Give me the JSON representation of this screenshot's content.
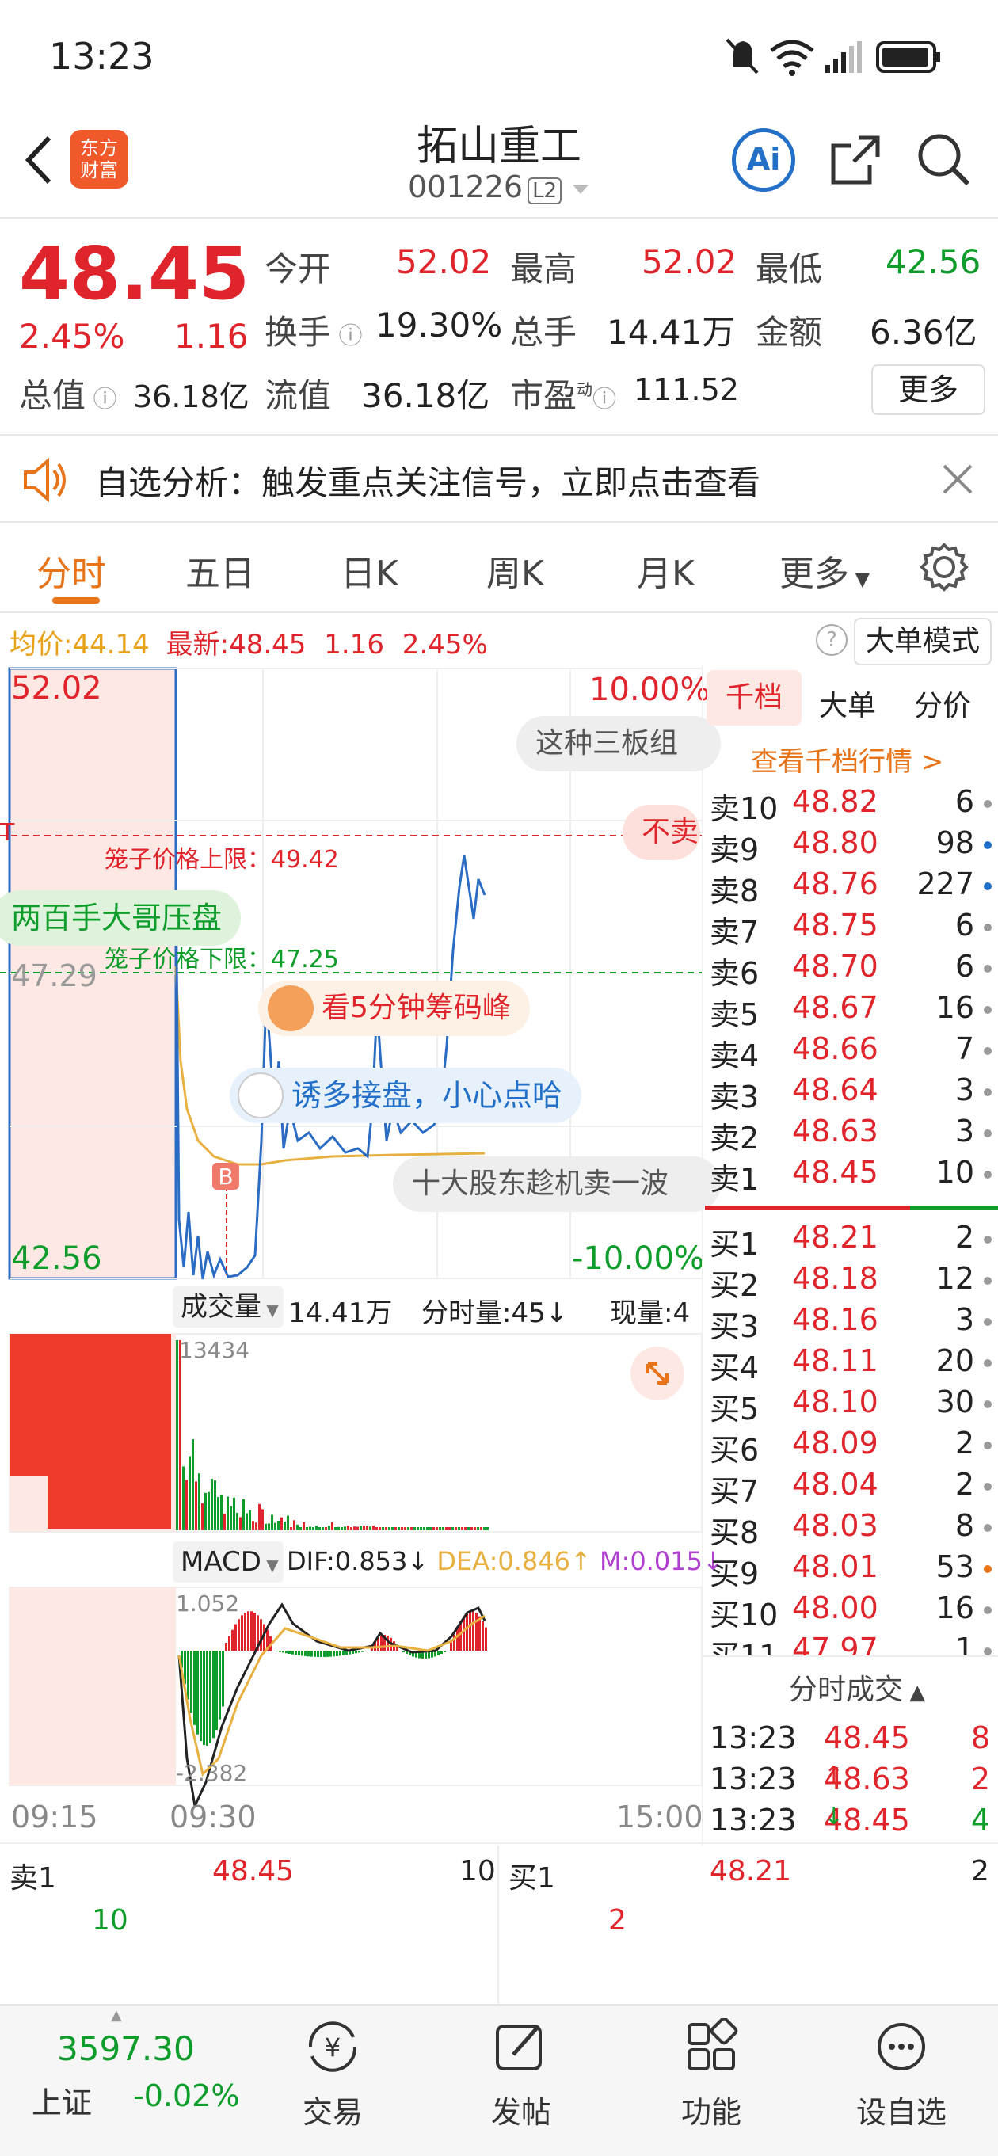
{
  "status_bar": {
    "time": "13:23"
  },
  "header": {
    "back_label": "<",
    "logo_text": "东方财富",
    "title": "拓山重工",
    "code": "001226",
    "level": "L2",
    "ai_label": "Ai"
  },
  "quote": {
    "price": "48.45",
    "change_pct": "2.45%",
    "change": "1.16",
    "open_label": "今开",
    "open": "52.02",
    "high_label": "最高",
    "high": "52.02",
    "low_label": "最低",
    "low": "42.56",
    "turnover_label": "换手",
    "turnover": "19.30%",
    "volume_label": "总手",
    "volume": "14.41万",
    "amount_label": "金额",
    "amount": "6.36亿",
    "mktcap_label": "总值",
    "mktcap": "36.18亿",
    "float_label": "流值",
    "float": "36.18亿",
    "pe_label": "市盈",
    "pe_sup": "动",
    "pe": "111.52",
    "more_label": "更多"
  },
  "banner": {
    "text": "自选分析：触发重点关注信号，立即点击查看"
  },
  "tabs": [
    "分时",
    "五日",
    "日K",
    "周K",
    "月K",
    "更多"
  ],
  "chart_header": {
    "avg_label": "均价:",
    "avg": "44.14",
    "latest_label": "最新:",
    "latest": "48.45",
    "latest_change": "1.16",
    "latest_pct": "2.45%",
    "big_order_label": "大单模式"
  },
  "chart": {
    "top_price": "52.02",
    "mid_price": "47.29",
    "bottom_price": "42.56",
    "top_pct": "10.00%",
    "bottom_pct": "-10.00%",
    "cage_upper": "笼子价格上限：49.42",
    "cage_lower": "笼子价格下限：47.25",
    "pill_1": "这种三板组",
    "pill_2": "不卖",
    "pill_3": "两百手大哥压盘",
    "pill_4": "看5分钟筹码峰",
    "pill_5": "诱多接盘，小心点哈",
    "pill_6": "十大股东趁机卖一波",
    "b_marker": "B",
    "left_edge_marker": "T"
  },
  "volume_header": {
    "selector": "成交量",
    "total": "14.41万",
    "minute_vol": "分时量:45↓",
    "now_vol": "现量:4"
  },
  "volume": {
    "max_label": "13434"
  },
  "macd_header": {
    "selector": "MACD",
    "dif": "DIF:0.853↓",
    "dea": "DEA:0.846↑",
    "m": "M:0.015↓"
  },
  "macd": {
    "max_label": "1.052",
    "min_label": "-2.382"
  },
  "time_axis": [
    "09:15",
    "09:30",
    "15:00"
  ],
  "orderbook": {
    "tabs": [
      "千档",
      "大单",
      "分价"
    ],
    "view_all": "查看千档行情 >",
    "asks": [
      {
        "label": "卖10",
        "price": "48.82",
        "qty": "6",
        "dot": "#999999"
      },
      {
        "label": "卖9",
        "price": "48.80",
        "qty": "98",
        "dot": "#2370c8"
      },
      {
        "label": "卖8",
        "price": "48.76",
        "qty": "227",
        "dot": "#2370c8"
      },
      {
        "label": "卖7",
        "price": "48.75",
        "qty": "6",
        "dot": "#999999"
      },
      {
        "label": "卖6",
        "price": "48.70",
        "qty": "6",
        "dot": "#999999"
      },
      {
        "label": "卖5",
        "price": "48.67",
        "qty": "16",
        "dot": "#999999"
      },
      {
        "label": "卖4",
        "price": "48.66",
        "qty": "7",
        "dot": "#999999"
      },
      {
        "label": "卖3",
        "price": "48.64",
        "qty": "3",
        "dot": "#999999"
      },
      {
        "label": "卖2",
        "price": "48.63",
        "qty": "3",
        "dot": "#999999"
      },
      {
        "label": "卖1",
        "price": "48.45",
        "qty": "10",
        "dot": "#999999"
      }
    ],
    "bids": [
      {
        "label": "买1",
        "price": "48.21",
        "qty": "2",
        "dot": "#999999"
      },
      {
        "label": "买2",
        "price": "48.18",
        "qty": "12",
        "dot": "#999999"
      },
      {
        "label": "买3",
        "price": "48.16",
        "qty": "3",
        "dot": "#999999"
      },
      {
        "label": "买4",
        "price": "48.11",
        "qty": "20",
        "dot": "#999999"
      },
      {
        "label": "买5",
        "price": "48.10",
        "qty": "30",
        "dot": "#999999"
      },
      {
        "label": "买6",
        "price": "48.09",
        "qty": "2",
        "dot": "#999999"
      },
      {
        "label": "买7",
        "price": "48.04",
        "qty": "2",
        "dot": "#999999"
      },
      {
        "label": "买8",
        "price": "48.03",
        "qty": "8",
        "dot": "#999999"
      },
      {
        "label": "买9",
        "price": "48.01",
        "qty": "53",
        "dot": "#e8741a"
      },
      {
        "label": "买10",
        "price": "48.00",
        "qty": "16",
        "dot": "#999999"
      },
      {
        "label": "买11",
        "price": "47.97",
        "qty": "1",
        "dot": "#999999"
      }
    ],
    "trades_title": "分时成交",
    "trades": [
      {
        "time": "13:23",
        "price": "48.45",
        "arrow": "",
        "qty": "8",
        "qty_color": "#e0242b"
      },
      {
        "time": "13:23",
        "price": "48.63",
        "arrow": "↑",
        "qty": "2",
        "qty_color": "#e0242b"
      },
      {
        "time": "13:23",
        "price": "48.45",
        "arrow": "↓",
        "qty": "4",
        "qty_color": "#0e9d2a"
      }
    ]
  },
  "bottom_quote": {
    "sell_label": "卖1",
    "sell_price": "48.45",
    "sell_qty": "10",
    "sell_sub": "10",
    "buy_label": "买1",
    "buy_price": "48.21",
    "buy_qty": "2",
    "buy_sub": "2"
  },
  "bottom_nav": {
    "index_value": "3597.30",
    "index_name": "上证",
    "index_change": "-0.02%",
    "items": [
      "交易",
      "发帖",
      "功能",
      "设自选"
    ]
  },
  "colors": {
    "up": "#e0242b",
    "down": "#0e9d2a",
    "accent": "#e8741a",
    "line": "#2a6cc4"
  }
}
